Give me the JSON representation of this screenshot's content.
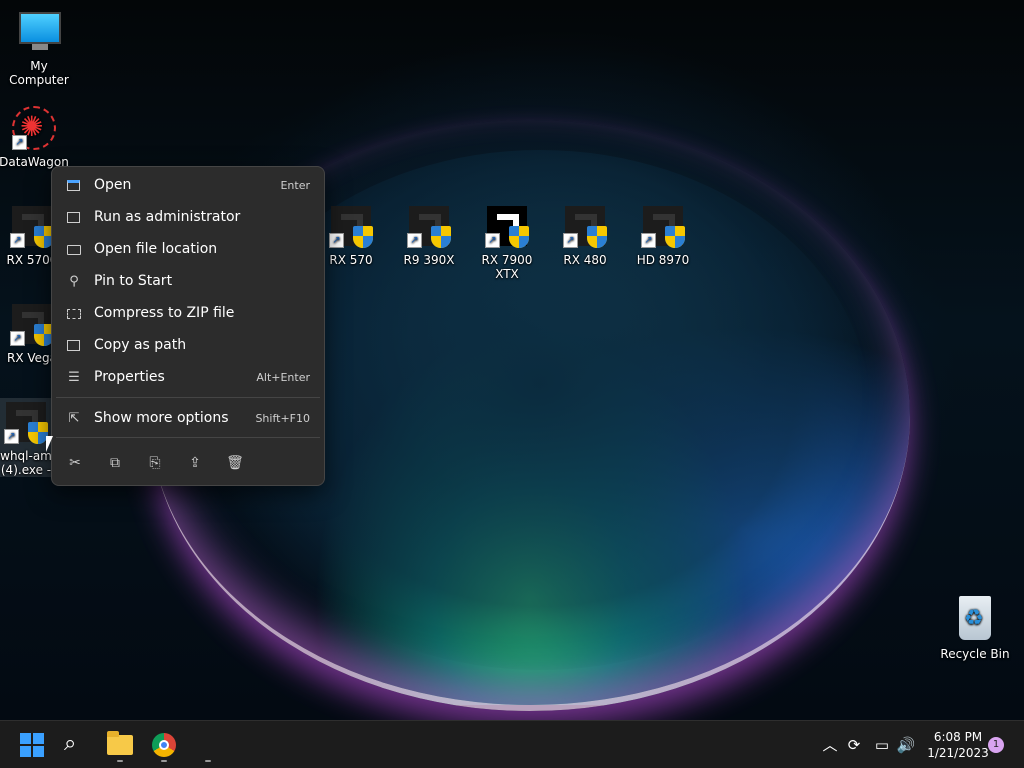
{
  "desktop": {
    "icons": [
      {
        "label": "My Computer"
      },
      {
        "label": "DataWagon"
      },
      {
        "label": "RX 5700"
      },
      {
        "label": "RX Vega"
      },
      {
        "label": "whql-am (4).exe -"
      },
      {
        "label": "RX 570"
      },
      {
        "label": "R9 390X"
      },
      {
        "label": "RX 7900 XTX"
      },
      {
        "label": "RX 480"
      },
      {
        "label": "HD 8970"
      },
      {
        "label": "Recycle Bin"
      }
    ]
  },
  "context_menu": {
    "items": [
      {
        "label": "Open",
        "shortcut": "Enter",
        "icon": "open-icon"
      },
      {
        "label": "Run as administrator",
        "shortcut": "",
        "icon": "shield-admin-icon"
      },
      {
        "label": "Open file location",
        "shortcut": "",
        "icon": "folder-icon"
      },
      {
        "label": "Pin to Start",
        "shortcut": "",
        "icon": "pin-icon"
      },
      {
        "label": "Compress to ZIP file",
        "shortcut": "",
        "icon": "zip-icon"
      },
      {
        "label": "Copy as path",
        "shortcut": "",
        "icon": "copy-path-icon"
      },
      {
        "label": "Properties",
        "shortcut": "Alt+Enter",
        "icon": "properties-icon"
      },
      {
        "label": "Show more options",
        "shortcut": "Shift+F10",
        "icon": "more-options-icon"
      }
    ],
    "action_bar": [
      "cut-icon",
      "copy-icon",
      "rename-icon",
      "share-icon",
      "delete-icon"
    ]
  },
  "taskbar": {
    "clock_time": "6:08 PM",
    "clock_date": "1/21/2023",
    "notification_count": "1"
  }
}
